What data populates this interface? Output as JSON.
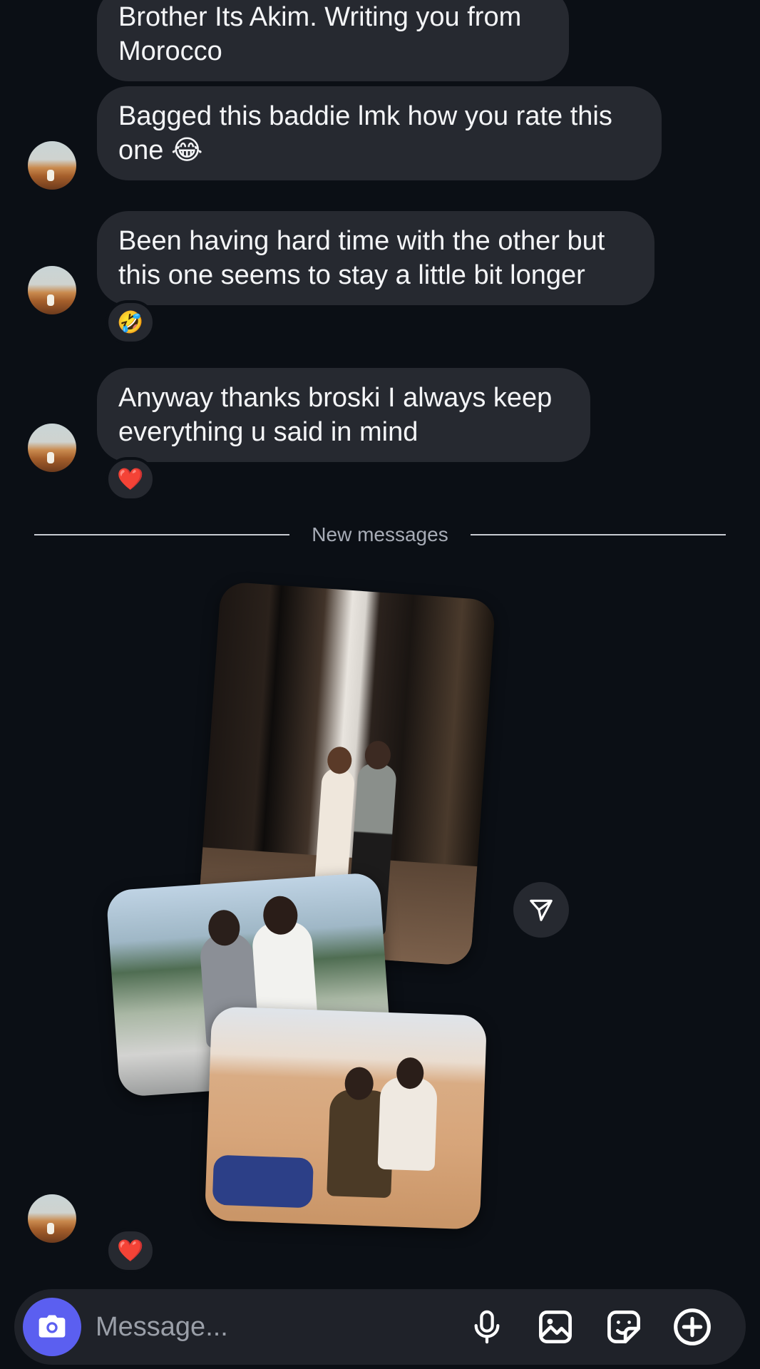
{
  "messages": [
    {
      "text": "Brother Its Akim. Writing you from Morocco"
    },
    {
      "text": "Bagged this baddie lmk how you rate this one 😂"
    },
    {
      "text": "Been having hard time with the other but this one seems to stay a little bit longer",
      "reaction": "🤣"
    },
    {
      "text": "Anyway thanks broski I always keep everything u said in mind",
      "reaction": "❤️"
    }
  ],
  "divider": {
    "label": "New messages"
  },
  "photo_post": {
    "reaction": "❤️"
  },
  "composer": {
    "placeholder": "Message..."
  },
  "colors": {
    "background": "#0b0f15",
    "bubble": "#262930",
    "composer": "#1f2229",
    "camera_button": "#5b5ff0"
  },
  "icons": {
    "share": "send-icon",
    "camera": "camera-icon",
    "mic": "microphone-icon",
    "gallery": "gallery-icon",
    "sticker": "sticker-icon",
    "more": "plus-circle-icon"
  }
}
